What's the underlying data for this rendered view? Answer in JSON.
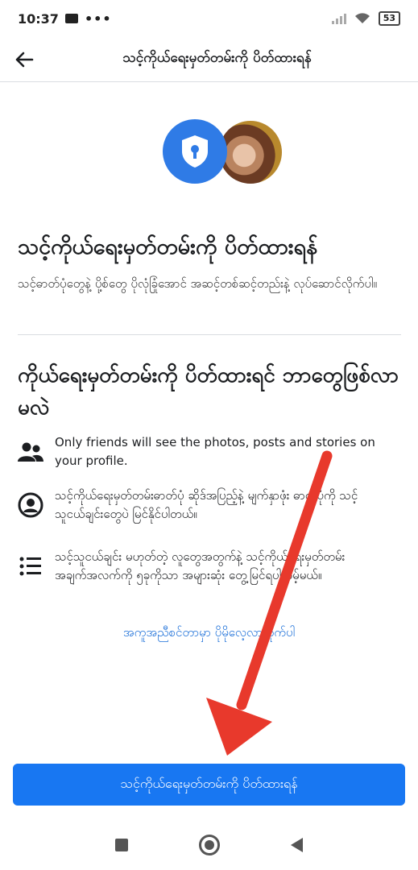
{
  "status_bar": {
    "time": "10:37",
    "battery": "53"
  },
  "header": {
    "title": "သင့်ကိုယ်ရေးမှတ်တမ်းကို ပိတ်ထားရန်"
  },
  "intro": {
    "title": "သင့်ကိုယ်ရေးမှတ်တမ်းကို ပိတ်ထားရန်",
    "description": "သင့်ဓာတ်ပုံတွေနဲ့ ပို့စ်တွေ ပိုလုံခြုံအောင် အဆင့်တစ်ဆင့်တည်းနဲ့ လုပ်ဆောင်လိုက်ပါ။"
  },
  "what_happens": {
    "title": "ကိုယ်ရေးမှတ်တမ်းကို ပိတ်ထားရင် ဘာတွေဖြစ်လာမလဲ",
    "items": [
      {
        "icon": "friends-icon",
        "text": "Only friends will see the photos, posts and stories on your profile."
      },
      {
        "icon": "profile-circle-icon",
        "text": "သင့်ကိုယ်ရေးမှတ်တမ်းဓာတ်ပုံ ဆိုဒ်အပြည့်နဲ့ မျက်နှာဖုံး ဓာတ်ပုံကို သင့်သူငယ်ချင်းတွေပဲ မြင်နိုင်ပါတယ်။"
      },
      {
        "icon": "list-icon",
        "text": "သင့်သူငယ်ချင်း မဟုတ်တဲ့ လူတွေအတွက်နဲ့ သင့်ကိုယ်ရေးမှတ်တမ်း အချက်အလက်ကို ၅ခုကိုသာ အများဆုံး တွေ့မြင်ရပါလိမ့်မယ်။"
      }
    ]
  },
  "help_link": "အကူအညီစင်တာမှာ ပိုမိုလေ့လာလိုက်ပါ",
  "primary_button": "သင့်ကိုယ်ရေးမှတ်တမ်းကို ပိတ်ထားရန်",
  "colors": {
    "accent": "#1877f2",
    "shield_bg": "#2f7be6",
    "arrow": "#e8392c"
  }
}
